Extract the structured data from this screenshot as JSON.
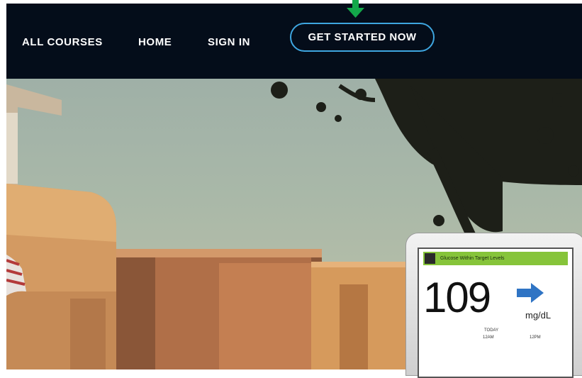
{
  "nav": {
    "items": [
      {
        "label": "ALL COURSES"
      },
      {
        "label": "HOME"
      },
      {
        "label": "SIGN IN"
      }
    ],
    "cta_label": "GET STARTED NOW",
    "background": "#040d1a",
    "cta_border_color": "#3ea6e0"
  },
  "annotation": {
    "icon": "arrow-down-icon",
    "color": "#13a84a"
  },
  "hero": {
    "device": {
      "status_text": "Glucose Within Target Levels",
      "reading": "109",
      "unit": "mg/dL",
      "day_label": "TODAY",
      "tick_left": "12AM",
      "tick_right": "12PM",
      "trend_icon": "right-arrow-icon"
    }
  }
}
